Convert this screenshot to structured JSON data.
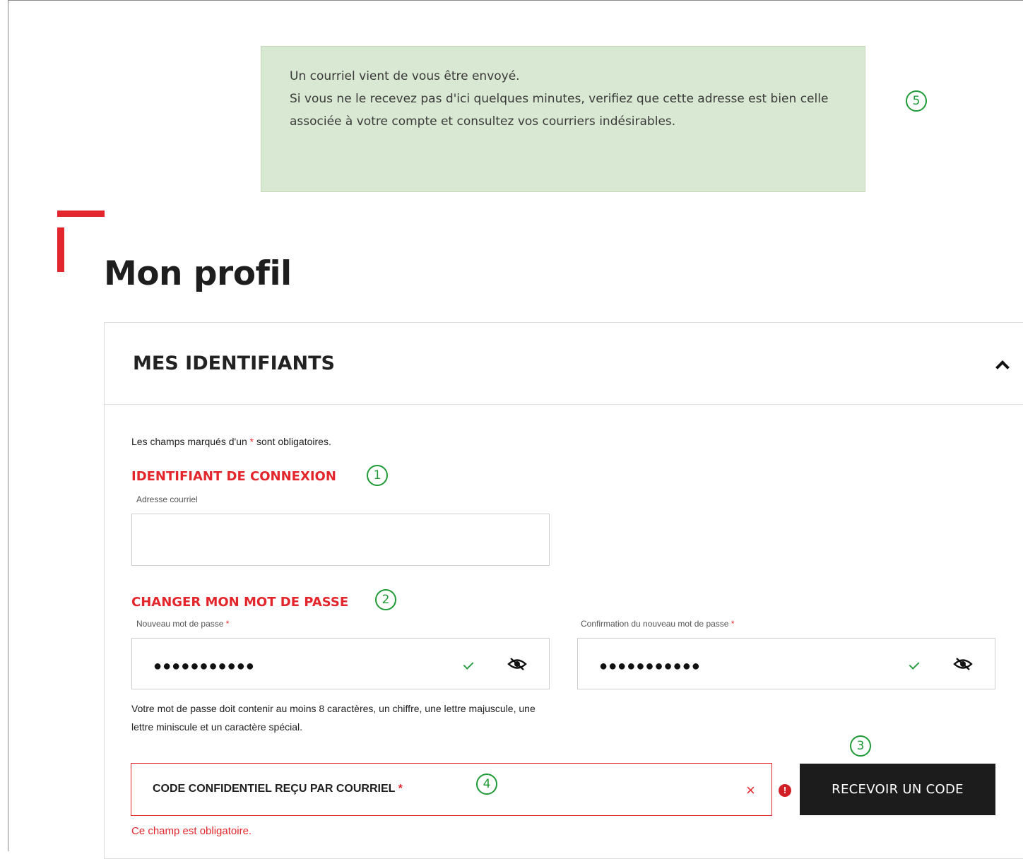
{
  "notice": {
    "line1": "Un courriel vient de vous être envoyé.",
    "line2": "Si vous ne le recevez pas d'ici quelques minutes, verifiez que cette adresse est bien celle associée à votre compte et consultez vos courriers indésirables."
  },
  "markers": {
    "m1": "1",
    "m2": "2",
    "m3": "3",
    "m4": "4",
    "m5": "5"
  },
  "page": {
    "title": "Mon profil"
  },
  "panel": {
    "title": "MES IDENTIFIANTS",
    "required_note_before": "Les champs marqués d'un ",
    "required_star": "*",
    "required_note_after": " sont obligatoires."
  },
  "login": {
    "section_label": "IDENTIFIANT DE CONNEXION",
    "email_label": "Adresse courriel",
    "email_value": ""
  },
  "password": {
    "section_label": "CHANGER MON MOT DE PASSE",
    "new_label": "Nouveau mot de passe",
    "confirm_label": "Confirmation du nouveau mot de passe",
    "star": "*",
    "new_value": "●●●●●●●●●●●",
    "confirm_value": "●●●●●●●●●●●",
    "help": "Votre mot de passe doit contenir au moins 8 caractères, un chiffre, une lettre majuscule, une lettre miniscule et un caractère spécial."
  },
  "code": {
    "label": "CODE CONFIDENTIEL REÇU PAR COURRIEL",
    "star": "*",
    "clear": "×",
    "error_icon": "!",
    "button_label": "RECEVOIR UN CODE",
    "error_message": "Ce champ est obligatoire."
  },
  "icons": {
    "check": "check-icon",
    "eye_off": "eye-off-icon",
    "chevron": "chevron-up-icon",
    "error": "error-icon",
    "clear": "close-icon"
  },
  "colors": {
    "accent": "#e3262b",
    "notice_bg": "#d9e8d2",
    "marker": "#1f9a37",
    "button_bg": "#1c1c1c",
    "check": "#2e9e43"
  }
}
